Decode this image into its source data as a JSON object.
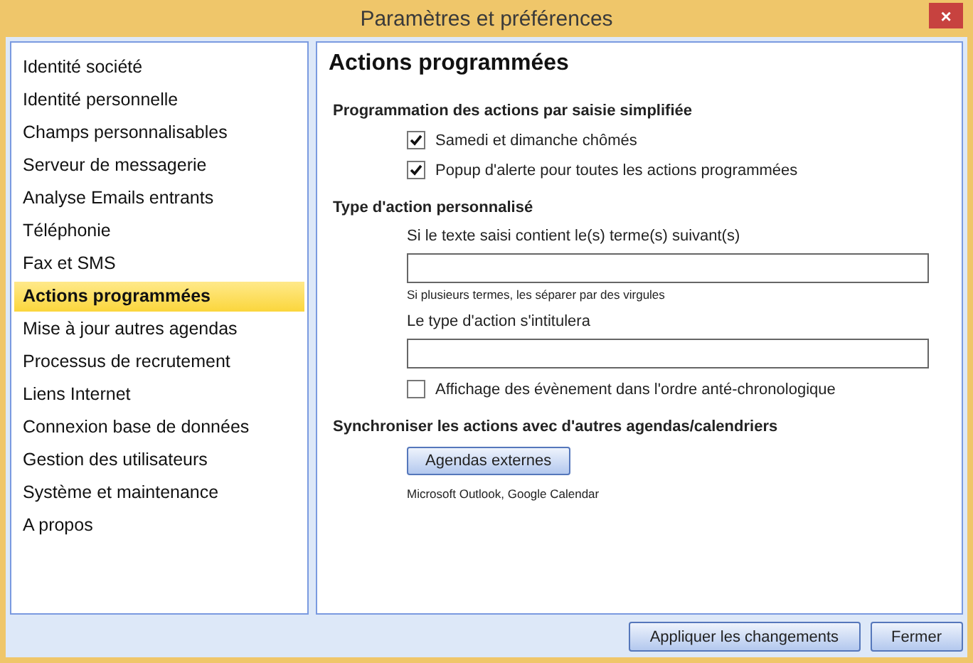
{
  "window": {
    "title": "Paramètres et préférences",
    "close": "×"
  },
  "sidebar": {
    "items": [
      {
        "label": "Identité société",
        "selected": false
      },
      {
        "label": "Identité personnelle",
        "selected": false
      },
      {
        "label": "Champs personnalisables",
        "selected": false
      },
      {
        "label": "Serveur de messagerie",
        "selected": false
      },
      {
        "label": "Analyse Emails entrants",
        "selected": false
      },
      {
        "label": "Téléphonie",
        "selected": false
      },
      {
        "label": "Fax et SMS",
        "selected": false
      },
      {
        "label": "Actions programmées",
        "selected": true
      },
      {
        "label": "Mise à jour autres agendas",
        "selected": false
      },
      {
        "label": "Processus de recrutement",
        "selected": false
      },
      {
        "label": "Liens Internet",
        "selected": false
      },
      {
        "label": "Connexion base de données",
        "selected": false
      },
      {
        "label": "Gestion des utilisateurs",
        "selected": false
      },
      {
        "label": "Système et maintenance",
        "selected": false
      },
      {
        "label": "A propos",
        "selected": false
      }
    ]
  },
  "main": {
    "title": "Actions programmées",
    "sections": [
      {
        "heading": "Programmation des actions par saisie simplifiée",
        "items": [
          {
            "kind": "checkbox",
            "label": "Samedi et dimanche chômés",
            "checked": true
          },
          {
            "kind": "checkbox",
            "label": "Popup d'alerte pour toutes les actions programmées",
            "checked": true
          }
        ]
      },
      {
        "heading": "Type d'action personnalisé",
        "items": [
          {
            "kind": "field",
            "label": "Si le texte saisi contient le(s) terme(s) suivant(s)",
            "hint": "Si plusieurs termes, les séparer par des virgules"
          },
          {
            "kind": "field",
            "label": "Le type d'action s'intitulera"
          },
          {
            "kind": "checkbox",
            "label": "Affichage des évènement dans l'ordre anté-chronologique",
            "checked": false
          }
        ]
      },
      {
        "heading": "Synchroniser les actions avec d'autres agendas/calendriers",
        "items": [
          {
            "kind": "button",
            "label": "Agendas externes",
            "note": "Microsoft Outlook, Google Calendar"
          }
        ]
      }
    ]
  },
  "buttons": [
    "Appliquer les changements",
    "Fermer"
  ]
}
